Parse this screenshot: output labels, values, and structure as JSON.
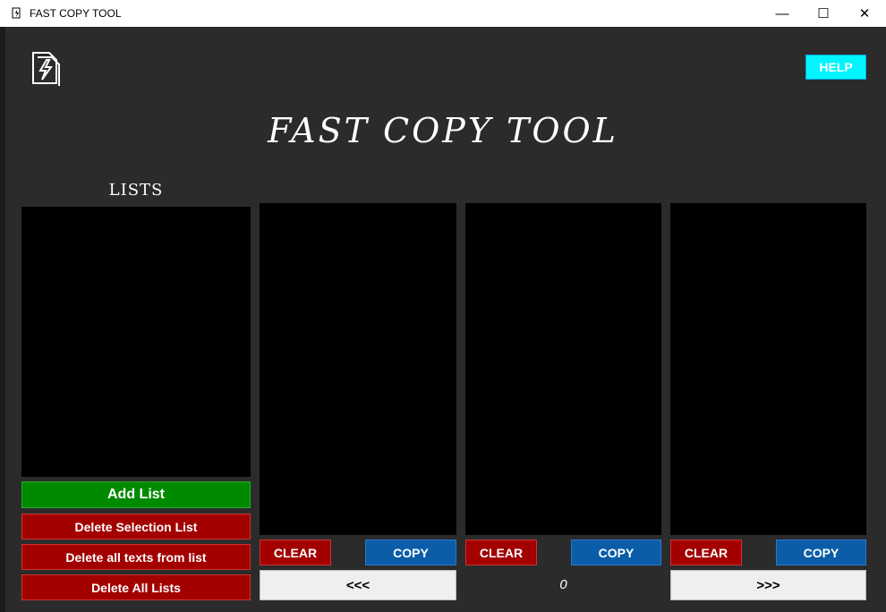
{
  "window": {
    "title": "FAST COPY TOOL",
    "minimize_glyph": "—",
    "maximize_glyph": "☐",
    "close_glyph": "✕"
  },
  "header": {
    "help_label": "HELP",
    "app_title": "FAST COPY TOOL",
    "logo_icon": "document-lightning-icon"
  },
  "lists_panel": {
    "label": "LISTS",
    "add_label": "Add List",
    "delete_selection_label": "Delete Selection List",
    "delete_texts_label": "Delete all texts from list",
    "delete_all_label": "Delete All Lists"
  },
  "text_panels": [
    {
      "clear_label": "CLEAR",
      "copy_label": "COPY"
    },
    {
      "clear_label": "CLEAR",
      "copy_label": "COPY"
    },
    {
      "clear_label": "CLEAR",
      "copy_label": "COPY"
    }
  ],
  "pagination": {
    "prev_label": "<<<",
    "page_number": "0",
    "next_label": ">>>"
  },
  "colors": {
    "background": "#2b2b2b",
    "help": "#00f5ff",
    "green": "#008a00",
    "red": "#a30000",
    "blue": "#0b5da8"
  }
}
